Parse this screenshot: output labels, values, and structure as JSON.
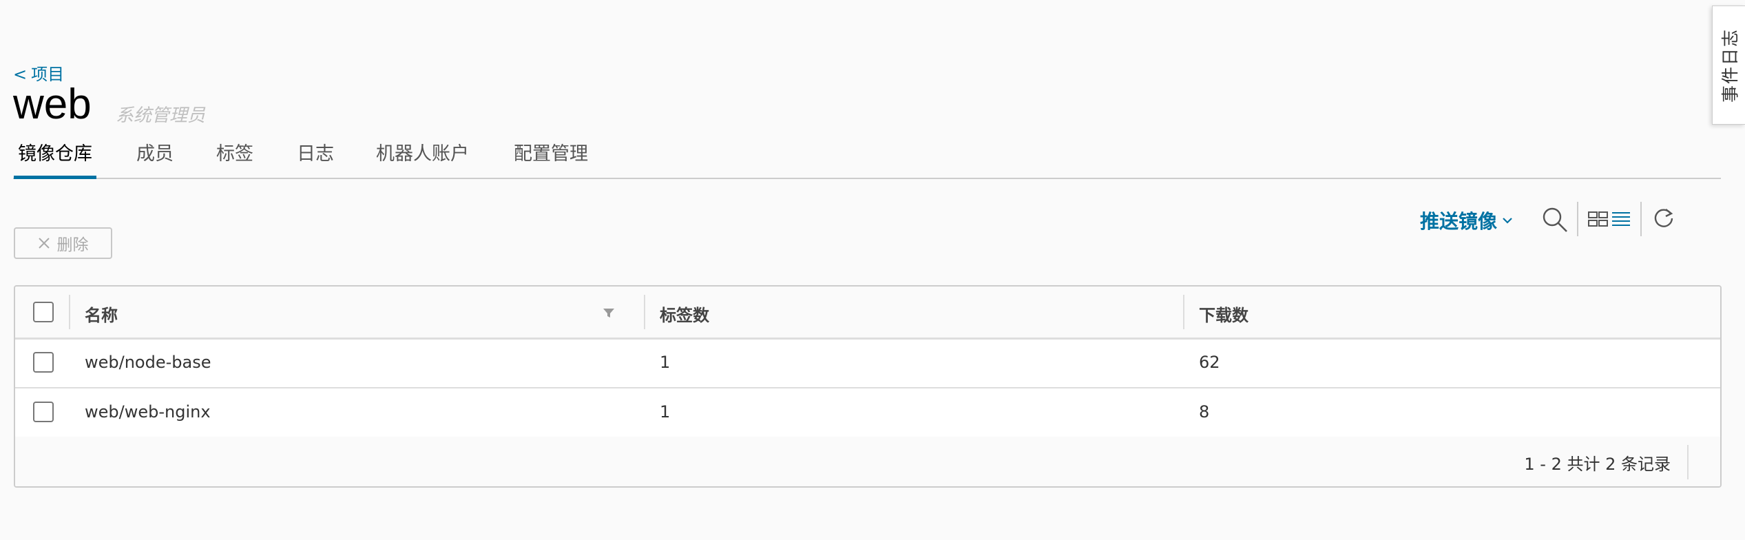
{
  "side_tab": {
    "label": "事件日志"
  },
  "breadcrumb": {
    "back_glyph": "<",
    "label": "项目"
  },
  "project": {
    "name": "web",
    "role": "系统管理员"
  },
  "tabs": [
    {
      "label": "镜像仓库",
      "active": true
    },
    {
      "label": "成员"
    },
    {
      "label": "标签"
    },
    {
      "label": "日志"
    },
    {
      "label": "机器人账户"
    },
    {
      "label": "配置管理"
    }
  ],
  "toolbar": {
    "delete_label": "删除",
    "push_label": "推送镜像",
    "icons": [
      "search-icon",
      "card-view-icon",
      "list-view-icon",
      "refresh-icon"
    ]
  },
  "table": {
    "columns": [
      "名称",
      "标签数",
      "下载数"
    ],
    "rows": [
      {
        "name": "web/node-base",
        "tags": "1",
        "downloads": "62"
      },
      {
        "name": "web/web-nginx",
        "tags": "1",
        "downloads": "8"
      }
    ],
    "summary": "1 - 2 共计 2 条记录"
  },
  "colors": {
    "accent": "#0072a3",
    "border": "#cccccc",
    "background": "#fafafa"
  }
}
